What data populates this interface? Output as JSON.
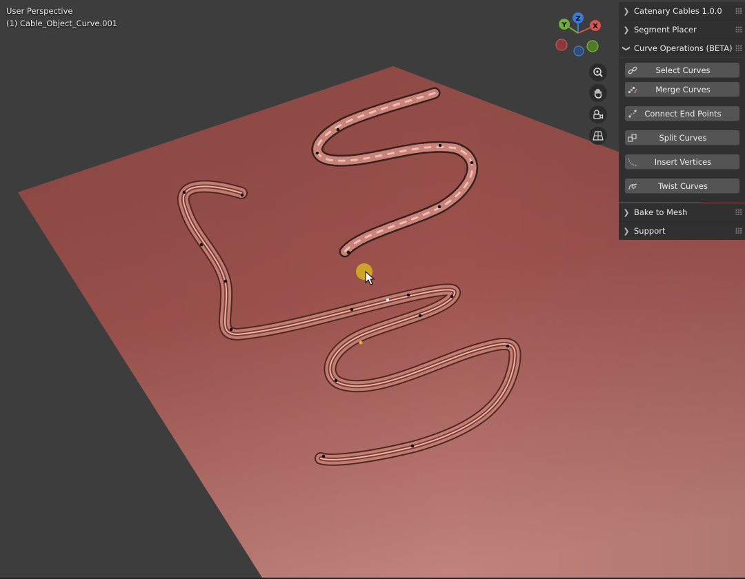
{
  "viewport": {
    "view_mode": "User Perspective",
    "active_object": "(1) Cable_Object_Curve.001"
  },
  "gizmo": {
    "axes": [
      {
        "label": "X",
        "color": "#d9534f"
      },
      {
        "label": "Y",
        "color": "#6fae3a"
      },
      {
        "label": "Z",
        "color": "#3a7bd5"
      }
    ],
    "nav_icons": [
      "zoom-icon",
      "hand-pan-icon",
      "camera-icon",
      "grid-icon"
    ]
  },
  "npanel": {
    "panels": [
      {
        "title": "Catenary Cables 1.0.0",
        "expanded": false
      },
      {
        "title": "Segment Placer",
        "expanded": false
      },
      {
        "title": "Curve Operations (BETA)",
        "expanded": true
      },
      {
        "title": "Bake to Mesh",
        "expanded": false
      },
      {
        "title": "Support",
        "expanded": false
      }
    ],
    "operations": [
      {
        "label": "Select Curves",
        "icon": "link-icon"
      },
      {
        "label": "Merge Curves",
        "icon": "merge-icon"
      },
      {
        "label": "Connect End Points",
        "icon": "connect-icon"
      },
      {
        "label": "Split Curves",
        "icon": "split-icon"
      },
      {
        "label": "Insert Vertices",
        "icon": "insert-vertices-icon"
      },
      {
        "label": "Twist Curves",
        "icon": "twist-icon"
      }
    ]
  },
  "colors": {
    "background": "#3d3d3d",
    "plane": "#a85e58",
    "cable": "#c98a7e",
    "panel": "#303030",
    "button": "#545454"
  }
}
